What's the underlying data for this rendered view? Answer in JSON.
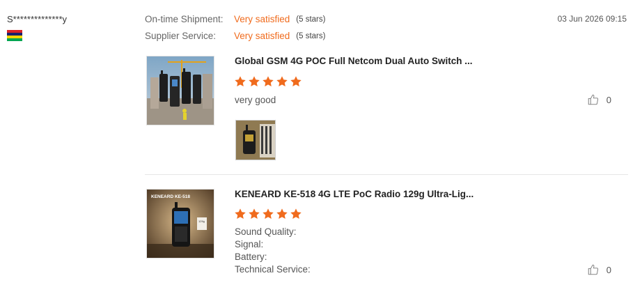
{
  "reviewer": {
    "name": "S**************y",
    "flag_colors": [
      "#da2128",
      "#1a206d",
      "#ffd500",
      "#00a551"
    ]
  },
  "review": {
    "date": "03 Jun 2026 09:15",
    "ratings": [
      {
        "label": "On-time Shipment:",
        "value": "Very satisfied",
        "stars": "(5 stars)"
      },
      {
        "label": "Supplier Service:",
        "value": "Very satisfied",
        "stars": "(5 stars)"
      }
    ]
  },
  "products": [
    {
      "title": "Global GSM 4G POC Full Netcom Dual Auto Switch ...",
      "rating": 5,
      "comment": "very good",
      "likes": "0",
      "thumb_icon": "walkie-talkie-product-image",
      "has_photo": true
    },
    {
      "title": "KENEARD KE-518 4G LTE PoC Radio 129g Ultra-Lig...",
      "rating": 5,
      "attributes": [
        "Sound Quality:",
        "Signal:",
        "Battery:",
        "Technical Service:"
      ],
      "likes": "0",
      "thumb_icon": "keneard-radio-product-image",
      "thumb_caption": "KENEARD KE-518",
      "thumb_tag": "129g"
    }
  ],
  "colors": {
    "accent": "#f06b1d",
    "star": "#f06b1d"
  },
  "icons": {
    "like": "thumbs-up-icon",
    "star": "star-icon"
  }
}
